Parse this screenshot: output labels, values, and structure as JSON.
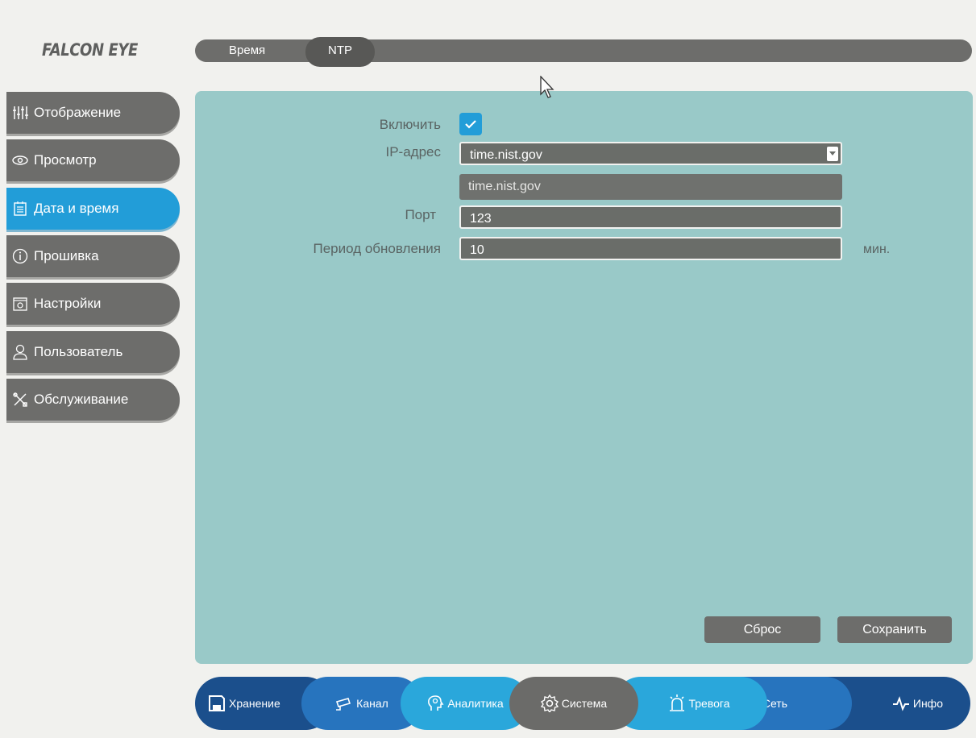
{
  "logo": "FALCON EYE",
  "tabs": [
    {
      "label": "Время"
    },
    {
      "label": "NTP"
    }
  ],
  "sidebar": {
    "items": [
      {
        "label": "Отображение",
        "icon": "sliders-icon"
      },
      {
        "label": "Просмотр",
        "icon": "eye-icon"
      },
      {
        "label": "Дата и время",
        "icon": "calendar-icon",
        "active": true
      },
      {
        "label": "Прошивка",
        "icon": "info-icon"
      },
      {
        "label": "Настройки",
        "icon": "settings-box-icon"
      },
      {
        "label": "Пользователь",
        "icon": "user-icon"
      },
      {
        "label": "Обслуживание",
        "icon": "tools-icon"
      }
    ]
  },
  "form": {
    "enable_label": "Включить",
    "enable_checked": true,
    "ip_label": "IP-адрес",
    "ip_value": "time.nist.gov",
    "ip_option": "time.nist.gov",
    "port_label": "Порт",
    "port_value": "123",
    "period_label": "Период обновления",
    "period_value": "10",
    "period_unit": "мин."
  },
  "buttons": {
    "reset": "Сброс",
    "save": "Сохранить"
  },
  "bottom_nav": [
    {
      "label": "Хранение",
      "icon": "save-icon"
    },
    {
      "label": "Канал",
      "icon": "camera-icon"
    },
    {
      "label": "Аналитика",
      "icon": "brain-icon"
    },
    {
      "label": "Система",
      "icon": "gear-icon",
      "active": true
    },
    {
      "label": "Тревога",
      "icon": "alarm-icon"
    },
    {
      "label": "Сеть",
      "icon": "network-icon"
    },
    {
      "label": "Инфо",
      "icon": "pulse-icon"
    }
  ],
  "colors": {
    "accent": "#229dd8",
    "panel": "#99c9c8",
    "sidebar": "#6d6d6b"
  }
}
